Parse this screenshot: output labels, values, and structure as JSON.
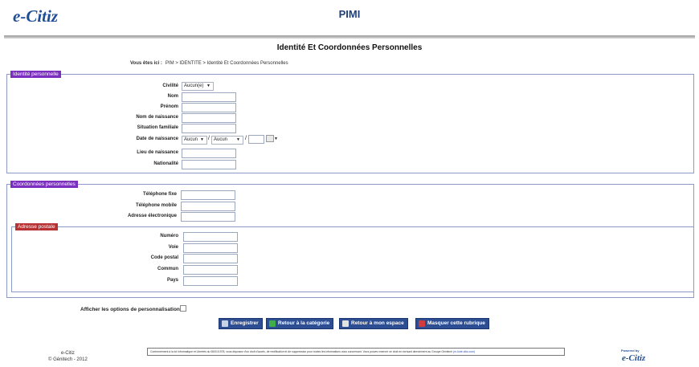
{
  "header": {
    "logo_text": "e-Citiz",
    "app_title": "PIMI"
  },
  "page_title": "Identité Et Coordonnées Personnelles",
  "breadcrumb": {
    "prefix": "Vous êtes ici :",
    "path": "PIM > IDENTITE > Identité Et Coordonnées Personnelles"
  },
  "identite": {
    "legend": "Identité personnelle",
    "civilite_label": "Civilité",
    "civilite_value": "Aucun(e)",
    "nom_label": "Nom",
    "nom_value": "",
    "prenom_label": "Prénom",
    "prenom_value": "",
    "nom_naissance_label": "Nom de naissance",
    "nom_naissance_value": "",
    "situation_label": "Situation familiale",
    "situation_value": "",
    "date_label": "Date de naissance",
    "date_day": "Aucun",
    "date_month": "Aucun",
    "date_sep": "/",
    "date_year": "",
    "lieu_label": "Lieu de naissance",
    "lieu_value": "",
    "nationalite_label": "Nationalité",
    "nationalite_value": ""
  },
  "coordonnees": {
    "legend": "Coordonnées personnelles",
    "tel_fixe_label": "Téléphone fixe",
    "tel_fixe_value": "",
    "tel_mobile_label": "Téléphone mobile",
    "tel_mobile_value": "",
    "email_label": "Adresse électronique",
    "email_value": ""
  },
  "adresse": {
    "legend": "Adresse postale",
    "numero_label": "Numéro",
    "numero_value": "",
    "voie_label": "Voie",
    "voie_value": "",
    "code_postal_label": "Code postal",
    "code_postal_value": "",
    "commune_label": "Commun",
    "commune_value": "",
    "pays_label": "Pays",
    "pays_value": ""
  },
  "options": {
    "label": "Afficher les options de personnalisation"
  },
  "buttons": {
    "save": "Enregistrer",
    "back_category": "Retour à la catégorie",
    "back_space": "Retour à mon espace",
    "hide": "Masquer cette rubrique"
  },
  "footer": {
    "brand": "e-Citiz",
    "copyright": "© Génitech - 2012",
    "notice_text": "Conformément à la loi Informatique et Libertés du 06/01/1978, vous disposez d'un droit d'accès, de rectification et de suppression pour toutes les informations vous concernant.  Vous pouvez exercer ce droit en écrivant directement au Groupe Génitech",
    "notice_link": "(m-hote-citiz.com)",
    "powered_by": "Powered by",
    "powered_logo": "e-Citiz"
  },
  "colors": {
    "brand_blue": "#1f4e96",
    "legend_purple": "#7b2fbe",
    "legend_red": "#b83233",
    "button_blue": "#2d4e93",
    "fieldset_border": "#8d99c9"
  }
}
